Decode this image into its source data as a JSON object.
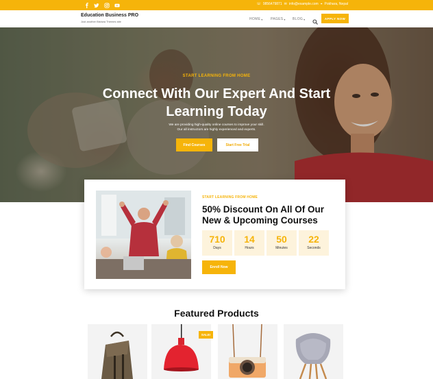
{
  "topbar": {
    "social_icons": [
      "facebook-icon",
      "twitter-icon",
      "instagram-icon",
      "youtube-icon"
    ],
    "contact": {
      "phone": "9856479871",
      "email": "info@example.com",
      "location": "Pokhara, Nepal"
    }
  },
  "header": {
    "site_title": "Education Business PRO",
    "tagline": "Just another Bishwa Themes site",
    "nav": [
      {
        "label": "HOME"
      },
      {
        "label": "PAGES"
      },
      {
        "label": "BLOG"
      }
    ],
    "apply_label": "APPLY NOW"
  },
  "hero": {
    "kicker": "START LEARNING FROM HOME",
    "title": "Connect With Our Expert And Start Learning Today",
    "desc_line1": "We are providing high-quality online courses to improve your skill.",
    "desc_line2": "Our all instructors are highly experienced and experts.",
    "primary_cta": "Find Courses",
    "secondary_cta": "Start Free Trial"
  },
  "promo": {
    "kicker": "START LEARNING FROM HOME",
    "title": "50% Discount On All Of Our New & Upcoming Courses",
    "countdown": [
      {
        "value": "710",
        "label": "Days"
      },
      {
        "value": "14",
        "label": "Hours"
      },
      {
        "value": "50",
        "label": "Minutes"
      },
      {
        "value": "22",
        "label": "Seconds"
      }
    ],
    "cta": "Enroll Now"
  },
  "featured": {
    "title": "Featured Products",
    "sale_badge": "SALE!"
  },
  "colors": {
    "accent": "#f6b40a",
    "text_dark": "#111111"
  }
}
